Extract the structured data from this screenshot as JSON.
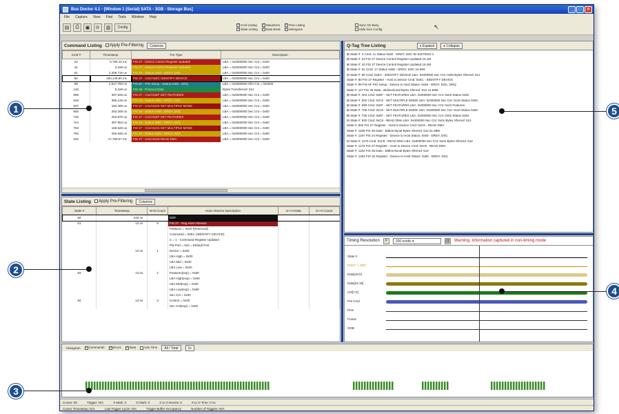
{
  "window": {
    "title": "Bus Doctor 4.1 - [Window 1 (Serial) SATA - 3GB - Storage Bus]"
  },
  "menu": [
    "File",
    "Capture",
    "View",
    "Find",
    "Tools",
    "Window",
    "Help"
  ],
  "toolbar": {
    "config_label": "Config",
    "checks": [
      {
        "label": "Cmd Listing",
        "on": true
      },
      {
        "label": "Waveform",
        "on": true
      },
      {
        "label": "Tree Listing",
        "on": true
      },
      {
        "label": "State Listing",
        "on": true
      },
      {
        "label": "Data Book",
        "on": true
      },
      {
        "label": "Histogram",
        "on": true
      }
    ],
    "checks2": [
      {
        "label": "Sync On Busy",
        "on": false
      },
      {
        "label": "Hide Gen Config",
        "on": false
      }
    ]
  },
  "command_listing": {
    "title": "Command Listing",
    "filter_label": "Apply Pre-Filtering",
    "columns_btn": "Columns",
    "headers": [
      "Cmd #",
      "Timestamp",
      "FIS Type",
      "Description"
    ],
    "rows": [
      {
        "n": "23",
        "ts": "5,706.16 ms",
        "fis": "FIS 27 - Device Control Register Updated",
        "desc": "LBA = 0x0000000  Sec Cnt = 0x00",
        "c": "#b01a1a"
      },
      {
        "n": "42",
        "ts": "2,168 us",
        "fis": "FIS 27 - Device Control Register Updated",
        "desc": "LBA = 0x0000000  Sec Cnt = 0x00",
        "c": "#c9a300"
      },
      {
        "n": "61",
        "ts": "2,408.716 us",
        "fis": "FIS 34 - Status 0x50 - DRDY, DSC",
        "desc": "LBA = 0x0000000  Sec Cnt = 0x00",
        "c": "#c9a300"
      },
      {
        "n": "80",
        "ts": "420,149.90 ms",
        "fis": "FIS 27 - Cmd 0xEC IDENTIFY DEVICE",
        "desc": "LBA = 0x0000000  Sec Cnt = 0x00",
        "c": "#9a1212"
      },
      {
        "n": "99",
        "ts": "2,517,750 ns",
        "fis": "FIS 5F - PIO Setup - Status 0x58 - DRQ",
        "desc": "LBA = 0x0000000  Xfer Cnt = 0x0200",
        "c": "#1a7f8c"
      },
      {
        "n": "118",
        "ts": "5,168 us",
        "fis": "FIS 46 - Protocol Data",
        "desc": "Bytes Transferred: 512",
        "c": "#1f8a4a"
      },
      {
        "n": "599",
        "ts": "397.926 us",
        "fis": "FIS 27 - Cmd 0xEF SET FEATURES",
        "desc": "LBA = 0x0000000  Sec Cnt = 0x00",
        "c": "#b01a1a"
      },
      {
        "n": "618",
        "ts": "385.126 us",
        "fis": "FIS 34 - Status 0x50 - DRDY, DSC",
        "desc": "LBA = 0x0000000  Sec Cnt = 0x00",
        "c": "#c9a300"
      },
      {
        "n": "637",
        "ts": "183.498 us",
        "fis": "FIS 27 - Cmd 0xC6 SET MULTIPLE MODE",
        "desc": "LBA = 0x0000000  Sec Cnt = 0x00",
        "c": "#9a1212"
      },
      {
        "n": "656",
        "ts": "253.408 us",
        "fis": "FIS 34 - Status 0x50 - DRDY, DSC",
        "desc": "LBA = 0x0000000  Sec Cnt = 0x00",
        "c": "#c9a300"
      },
      {
        "n": "725",
        "ts": "263.870 us",
        "fis": "FIS 27 - Cmd 0xEF SET FEATURES",
        "desc": "LBA = 0x0000000  Sec Cnt = 0x00",
        "c": "#b01a1a"
      },
      {
        "n": "744",
        "ts": "397.953 us",
        "fis": "FIS 34 - Status 0x50 - DRDY, DSC",
        "desc": "LBA = 0x0000000  Sec Cnt = 0x00",
        "c": "#c9a300"
      },
      {
        "n": "763",
        "ts": "168.528 us",
        "fis": "FIS 27 - Cmd 0xC6 SET MULTIPLE MODE",
        "desc": "LBA = 0x0000000  Sec Cnt = 0x00",
        "c": "#9a1212"
      },
      {
        "n": "782",
        "ts": "255.846 us",
        "fis": "FIS 34 - Status 0x50 - DRDY, DSC",
        "desc": "LBA = 0x0000000  Sec Cnt = 0x00",
        "c": "#c9a300"
      },
      {
        "n": "832",
        "ts": "17,769.57 ms",
        "fis": "FIS 27 - Cmd 0xC8 READ DMA",
        "desc": "LBA = 0x0000000  Sec Cnt = 0x00",
        "c": "#b01a1a"
      }
    ]
  },
  "state_listing": {
    "title": "State Listing",
    "filter_label": "Apply Pre-Filtering",
    "columns_btn": "Columns",
    "headers": [
      "State #",
      "Timestamp",
      "M+D Count",
      "Host->Device Description",
      "D->H Data",
      "D->H Count"
    ],
    "rows": [
      {
        "n": "58",
        "ts": "240 ns",
        "cnt": "",
        "desc": "SOF",
        "dark": "#111"
      },
      {
        "n": "61",
        "ts": "13 ns",
        "cnt": "9",
        "desc": "FIS 27 - Reg Host->Device",
        "dark": "#8e1b1b"
      },
      {
        "n": "",
        "ts": "",
        "cnt": "",
        "desc": "Features = 0x00 (Reserved)"
      },
      {
        "n": "",
        "ts": "",
        "cnt": "",
        "desc": "Command = 0xEC (IDENTIFY DEVICE)"
      },
      {
        "n": "",
        "ts": "",
        "cnt": "",
        "desc": "C = 1 - Command Register Updated"
      },
      {
        "n": "",
        "ts": "",
        "cnt": "",
        "desc": "PM Port = 0x0 = Default Port"
      },
      {
        "n": "",
        "ts": "12 ns",
        "cnt": "1",
        "desc": "Device = 0x00"
      },
      {
        "n": "",
        "ts": "",
        "cnt": "",
        "desc": "LBA High = 0x00"
      },
      {
        "n": "",
        "ts": "",
        "cnt": "",
        "desc": "LBA Mid = 0x00"
      },
      {
        "n": "",
        "ts": "",
        "cnt": "",
        "desc": "LBA Low = 0x00"
      },
      {
        "n": "83",
        "ts": "13 ns",
        "cnt": "2",
        "desc": "Features(exp) = 0x00"
      },
      {
        "n": "",
        "ts": "",
        "cnt": "",
        "desc": "LBA High(exp) = 0x00"
      },
      {
        "n": "",
        "ts": "",
        "cnt": "",
        "desc": "LBA Mid(exp) = 0x00"
      },
      {
        "n": "",
        "ts": "",
        "cnt": "",
        "desc": "LBA Low(exp) = 0x00"
      },
      {
        "n": "",
        "ts": "",
        "cnt": "",
        "desc": "Sec Cnt = 0x00"
      },
      {
        "n": "84",
        "ts": "13 ns",
        "cnt": "3",
        "desc": "Control = 0x00"
      },
      {
        "n": "",
        "ts": "",
        "cnt": "",
        "desc": "Sec Cnt(exp) = 0x00"
      }
    ]
  },
  "tree": {
    "title": "Q-Tag Tree Listing",
    "expand": "Expand",
    "collapse": "Collapse",
    "lines": [
      "⊞ State #: 4   Cmd: 11  Status 0x50 - DRDY, DSC   9s 63270022 s",
      "⊞ State #: 23   FIS 27  Device Control Register Updated   16.1M",
      "⊞ State #: 42   FIS 27  Device Control Register Updated   16.2M",
      "⊞ State #: 61   Cmd: 17  Status 0x50 - DRDY, DSC   16.99S",
      "⊟ State #: 80  Cmd: 0xEC - IDENTIFY DEVICE  LBA: 0x000000  Sec Cnt: 0x00  Bytes Xferred: 512",
      "      State #: 80   FIS 27  Register - Host to Device   Cmd: 0xEC - IDENTIFY DEVICE",
      "      State #: 99   FIS 5F  PIO Setup - Device to Host   Status: 0x58 - DRDY, DSC, DRQ",
      "      State #: 117   FIS 46  Data - Bidirectional   Bytes Xferred: 512   21.59M",
      "⊞ State #: 404  Cmd: 0xEF - SET FEATURES  LBA: 0x000000  Sec Cnt: 0x03  Status 0x50",
      "⊞ State #: 502  Cmd: 0xC6 - SET MULTIPLE MODE  LBA: 0x000000  Sec Cnt: 0x10  Status 0x50",
      "⊞ State #: 599  Cmd: 0xEF - SET FEATURES  LBA: 0x000000  Sec Cnt: 0x42  Features",
      "⊞ State #: 706  Cmd: 0xC6 - SET MULTIPLE MODE  LBA: 0x000000  Sec Cnt: 0x10  Status 0x50",
      "⊞ State #: 725  Cmd: 0xEF - SET FEATURES  LBA: 0x000000  Sec Cnt: 0x02  Status 0x50",
      "⊟ State #: 832  Cmd: 0xC8 - READ DMA  LBA: 0x000000  Sec Cnt: 0x01  Bytes Xferred: 512",
      "      State #: 832   FIS 27  Register - Host to Device   Cmd: 0xC8 - READ DMA",
      "      State #: 1158   FIS 46  Data - Bidirectional   Bytes Xferred: 512   21.59M",
      "      State #: 1197   FIS 34  Register - Device to Host   Status: 0x50 - DRDY, DSC",
      "⊟ State #: 1179  Cmd: 0xC8 - READ DMA  LBA: 0x000000  Sec Cnt: 0x01  Bytes Xferred: 512",
      "      State #: 1179   FIS 27  Register - Host to Device   Cmd: 0xC8 - READ DMA",
      "      State #: 1183   FIS 46  Data - Bidirectional   Bytes Xferred: 512",
      "      State #: 1204   FIS 34  Register - Device to Host   Status: 0x50 - DRDY, DSC"
    ]
  },
  "waveform": {
    "label": "Timing Resolution",
    "resolution": "200 ns/div",
    "warning": "Warning: Information captured in non-timing mode",
    "lanes": [
      {
        "name": "State #",
        "color": "#000"
      },
      {
        "name": "FIS27 -> D07",
        "color": "#c88c00"
      },
      {
        "name": "Data[15:0]",
        "color": "#e0c890"
      },
      {
        "name": "Data[31:16]",
        "color": "#8a7a10"
      },
      {
        "name": "Ctrl[7:0]",
        "color": "#1a7a1a"
      },
      {
        "name": "FIS Cmd",
        "color": "#4a58b8"
      },
      {
        "name": "Prim",
        "color": "#333"
      },
      {
        "name": "Frame",
        "color": "#333"
      },
      {
        "name": "OOB",
        "color": "#333"
      }
    ]
  },
  "histogram": {
    "label": "Histogram",
    "checks": [
      {
        "label": "Commands",
        "on": true
      },
      {
        "label": "Errors",
        "on": true
      },
      {
        "label": "Data",
        "on": true
      },
      {
        "label": "Use Time",
        "on": false
      }
    ],
    "range": "All / Total",
    "zoom": "1x"
  },
  "status": {
    "row1": [
      "Cursor: 80",
      "Trigger: N/A",
      "X Mark: 0",
      "O Mark: 0",
      "X to O Events: 0",
      "X to O Time: 0 ns"
    ],
    "row2": [
      "Cursor Timestamp: N/A",
      "Last Trigger Cycle: N/A",
      "Trigger Buffer Occupancy",
      "Number of Triggers: N/A"
    ]
  },
  "callouts": [
    "1",
    "2",
    "3",
    "4",
    "5"
  ]
}
